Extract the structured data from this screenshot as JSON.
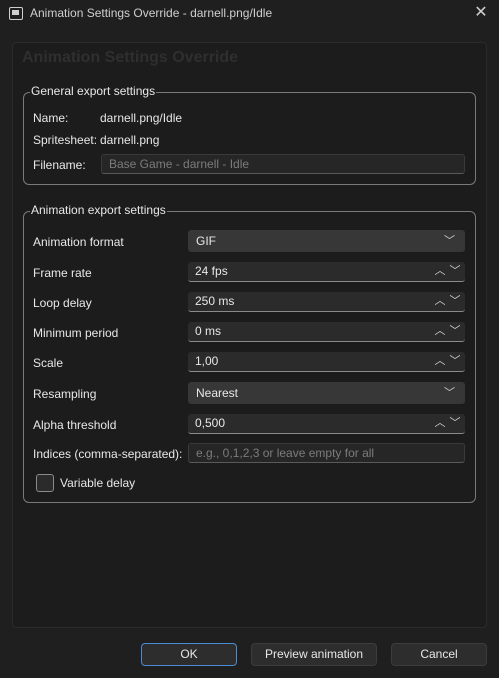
{
  "window": {
    "title": "Animation Settings Override - darnell.png/Idle"
  },
  "heading": "Animation Settings Override",
  "general": {
    "title": "General export settings",
    "name_label": "Name:",
    "name_value": "darnell.png/Idle",
    "spritesheet_label": "Spritesheet:",
    "spritesheet_value": "darnell.png",
    "filename_label": "Filename:",
    "filename_placeholder": "Base Game - darnell - Idle"
  },
  "animation": {
    "title": "Animation export settings",
    "format_label": "Animation format",
    "format_value": "GIF",
    "frame_rate_label": "Frame rate",
    "frame_rate_value": "24 fps",
    "loop_delay_label": "Loop delay",
    "loop_delay_value": "250 ms",
    "min_period_label": "Minimum period",
    "min_period_value": "0 ms",
    "scale_label": "Scale",
    "scale_value": "1,00",
    "resampling_label": "Resampling",
    "resampling_value": "Nearest",
    "alpha_label": "Alpha threshold",
    "alpha_value": "0,500",
    "indices_label": "Indices (comma-separated):",
    "indices_placeholder": "e.g., 0,1,2,3 or leave empty for all",
    "variable_delay_label": "Variable delay",
    "variable_delay_checked": false
  },
  "buttons": {
    "ok": "OK",
    "preview": "Preview animation",
    "cancel": "Cancel"
  },
  "colors": {
    "accent": "#4a8bd1",
    "background": "#1f1f1f"
  }
}
